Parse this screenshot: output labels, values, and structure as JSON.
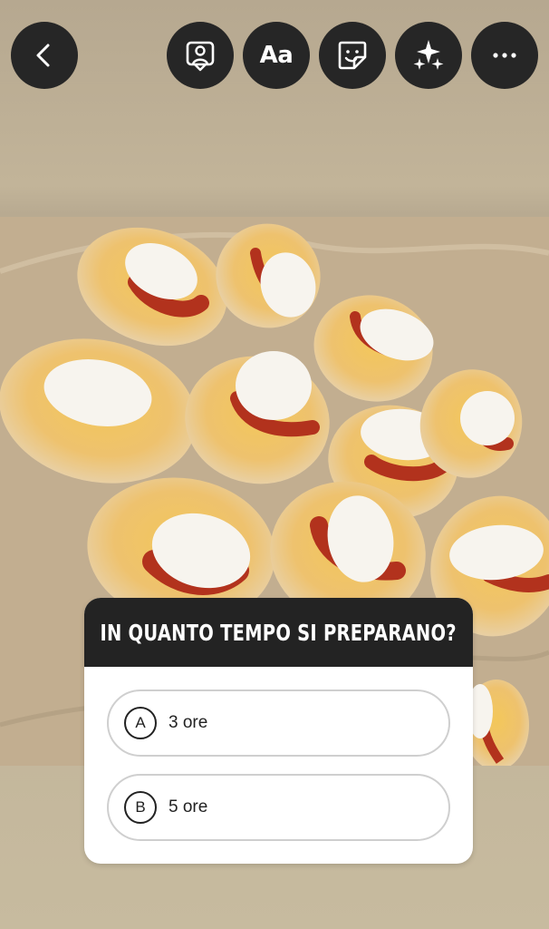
{
  "toolbar": {
    "back_icon": "chevron-left-icon",
    "buttons": [
      {
        "name": "mention",
        "icon": "person-frame-icon"
      },
      {
        "name": "text",
        "label": "Aa"
      },
      {
        "name": "sticker",
        "icon": "sticker-icon"
      },
      {
        "name": "effects",
        "icon": "sparkles-icon"
      },
      {
        "name": "more",
        "icon": "more-dots-icon"
      }
    ]
  },
  "photo": {
    "subject": "photo-image"
  },
  "quiz": {
    "question": "IN QUANTO TEMPO SI PREPARANO?",
    "options": [
      {
        "letter": "A",
        "text": "3 ore"
      },
      {
        "letter": "B",
        "text": "5 ore"
      }
    ]
  },
  "colors": {
    "button_bg": "#262626",
    "quiz_header_bg": "#232323",
    "option_border": "#cfcfcf"
  }
}
